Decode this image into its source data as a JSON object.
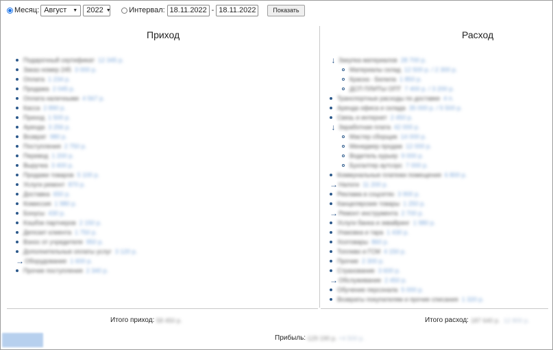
{
  "toolbar": {
    "month_label": "Месяц:",
    "month_value": "Август",
    "year_value": "2022",
    "interval_label": "Интервал:",
    "date_from": "18.11.2022",
    "separator": "-",
    "date_to": "18.11.2022",
    "show_button": "Показать"
  },
  "income": {
    "title": "Приход",
    "items": [
      {
        "name": "Подарочный сертификат",
        "amount": "12 345 р."
      },
      {
        "name": "Заказ номер 245",
        "amount": "3 000 р."
      },
      {
        "name": "Оплата",
        "amount": "1 234 р."
      },
      {
        "name": "Продажа",
        "amount": "2 045 р."
      },
      {
        "name": "Оплата наличными",
        "amount": "4 567 р."
      },
      {
        "name": "Касса",
        "amount": "2 890 р."
      },
      {
        "name": "Приход",
        "amount": "1 500 р."
      },
      {
        "name": "Аренда",
        "amount": "3 256 р."
      },
      {
        "name": "Возврат",
        "amount": "980 р."
      },
      {
        "name": "Поступления",
        "amount": "2 750 р."
      },
      {
        "name": "Перевод",
        "amount": "1 200 р."
      },
      {
        "name": "Выручка",
        "amount": "3 400 р."
      },
      {
        "name": "Продажи товаров",
        "amount": "5 100 р."
      },
      {
        "name": "Услуги ремонт",
        "amount": "870 р."
      },
      {
        "name": "Доставка",
        "amount": "650 р."
      },
      {
        "name": "Комиссия",
        "amount": "1 980 р."
      },
      {
        "name": "Бонусы",
        "amount": "430 р."
      },
      {
        "name": "Кэшбэк партнеров",
        "amount": "2 150 р."
      },
      {
        "name": "Депозит клиента",
        "amount": "1 750 р."
      },
      {
        "name": "Взнос от учредителя",
        "amount": "950 р."
      },
      {
        "name": "Дополнительные оплаты услуг",
        "amount": "3 120 р."
      },
      {
        "name": "Оборудование",
        "amount": "1 600 р.",
        "arrow": true
      },
      {
        "name": "Прочие поступления",
        "amount": "2 340 р."
      }
    ]
  },
  "expense": {
    "title": "Расход",
    "items": [
      {
        "name": "Закупка материалов",
        "amount": "28 700 р.",
        "arrow": true
      },
      {
        "name": "Материалы склад",
        "amount": "12 500 р. / 2 300 р.",
        "sub": true
      },
      {
        "name": "Краска - Белила",
        "amount": "1 850 р.",
        "sub": true
      },
      {
        "name": "ДСП ПЛИТЫ ОПТ",
        "amount": "7 400 р. / 3 200 р.",
        "sub": true
      },
      {
        "name": "Транспортные расходы по доставке",
        "amount": "4 п."
      },
      {
        "name": "Аренда офиса и склада",
        "amount": "35 000 р. / 5 500 р."
      },
      {
        "name": "Связь и интернет",
        "amount": "2 450 р."
      },
      {
        "name": "Заработная плата",
        "amount": "42 000 р.",
        "arrow": true
      },
      {
        "name": "Мастер сборщик",
        "amount": "14 000 р.",
        "sub": true
      },
      {
        "name": "Менеджер продаж",
        "amount": "12 000 р.",
        "sub": true
      },
      {
        "name": "Водитель курьер",
        "amount": "9 000 р.",
        "sub": true
      },
      {
        "name": "Бухгалтер аутсорс",
        "amount": "7 000 р.",
        "sub": true
      },
      {
        "name": "Коммунальные платежи помещения",
        "amount": "6 800 р."
      },
      {
        "name": "Налоги",
        "amount": "11 200 р.",
        "arrow": true
      },
      {
        "name": "Реклама в соцсетях",
        "amount": "3 900 р."
      },
      {
        "name": "Канцелярские товары",
        "amount": "1 250 р."
      },
      {
        "name": "Ремонт инструмента",
        "amount": "2 700 р.",
        "arrow": true
      },
      {
        "name": "Услуги банка и эквайринг",
        "amount": "1 980 р."
      },
      {
        "name": "Упаковка и тара",
        "amount": "1 430 р."
      },
      {
        "name": "Хозтовары",
        "amount": "860 р."
      },
      {
        "name": "Топливо и ГСМ",
        "amount": "4 150 р."
      },
      {
        "name": "Прочие",
        "amount": "2 300 р."
      },
      {
        "name": "Страхование",
        "amount": "3 600 р."
      },
      {
        "name": "Обслуживание",
        "amount": "2 450 р.",
        "arrow": true
      },
      {
        "name": "Обучение персонала",
        "amount": "5 000 р."
      },
      {
        "name": "Возвраты покупателям и прочие списания",
        "amount": "1 320 р."
      }
    ]
  },
  "totals": {
    "income_label": "Итого приход:",
    "income_value": "58 450 р.",
    "expense_label": "Итого расход:",
    "expense_value": "187 640 р.",
    "expense_value2": "12 800 р.",
    "profit_label": "Прибыль:",
    "profit_value": "-129 190 р.",
    "profit_value2": "+4 500 р."
  }
}
